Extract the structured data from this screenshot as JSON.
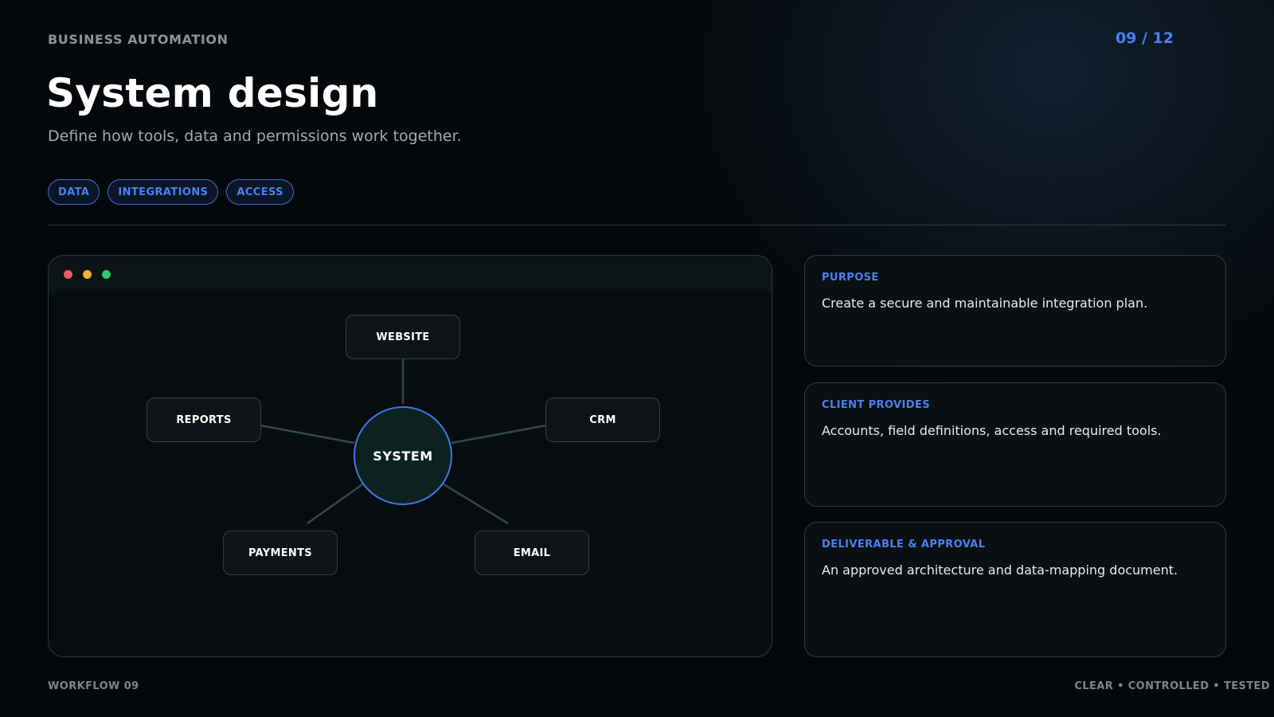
{
  "header": {
    "eyebrow": "BUSINESS AUTOMATION",
    "page_counter": "09 / 12",
    "title": "System design",
    "subtitle": "Define how tools, data and permissions work together."
  },
  "tags": [
    "DATA",
    "INTEGRATIONS",
    "ACCESS"
  ],
  "diagram": {
    "hub": "SYSTEM",
    "nodes": {
      "website": "WEBSITE",
      "reports": "REPORTS",
      "crm": "CRM",
      "payments": "PAYMENTS",
      "email": "EMAIL"
    }
  },
  "cards": [
    {
      "label": "PURPOSE",
      "text": "Create a secure and maintainable integration plan."
    },
    {
      "label": "CLIENT PROVIDES",
      "text": "Accounts, field definitions, access and required tools."
    },
    {
      "label": "DELIVERABLE & APPROVAL",
      "text": "An approved architecture and data-mapping document."
    }
  ],
  "footer": {
    "left": "WORKFLOW 09",
    "right": "CLEAR • CONTROLLED • TESTED"
  },
  "colors": {
    "accent": "#4a82f0",
    "background": "#05080b",
    "hub_fill": "#0b221f",
    "connector": "#2f4a48",
    "window_dot_red": "#ec5a5f",
    "window_dot_yellow": "#f1b13b",
    "window_dot_green": "#33c56c"
  }
}
